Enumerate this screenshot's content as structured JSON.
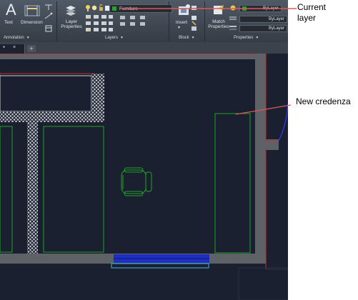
{
  "ribbon": {
    "annotation": {
      "text_label": "Text",
      "dimension_label": "Dimension",
      "panel_title": "Annotation"
    },
    "layers": {
      "layer_properties_label_1": "Layer",
      "layer_properties_label_2": "Properties",
      "current_layer": "Furniture",
      "current_layer_color": "#26a32d",
      "panel_title": "Layers"
    },
    "block": {
      "insert_label": "Insert",
      "panel_title": "Block"
    },
    "properties": {
      "match_label_1": "Match",
      "match_label_2": "Properties",
      "color": "ByLayer",
      "linetype": "ByLayer",
      "lineweight": "ByLayer",
      "panel_title": "Properties"
    }
  },
  "tabs": {
    "active_tab": "*",
    "add_tab": "+"
  },
  "callouts": {
    "current_layer_line1": "Current",
    "current_layer_line2": "layer",
    "new_credenza": "New credenza"
  },
  "colors": {
    "background": "#1a2030",
    "wall": "#5e6166",
    "furniture": "#1fa324",
    "selection_window": "#1d2fc4",
    "callout_leader": "#e05858"
  }
}
